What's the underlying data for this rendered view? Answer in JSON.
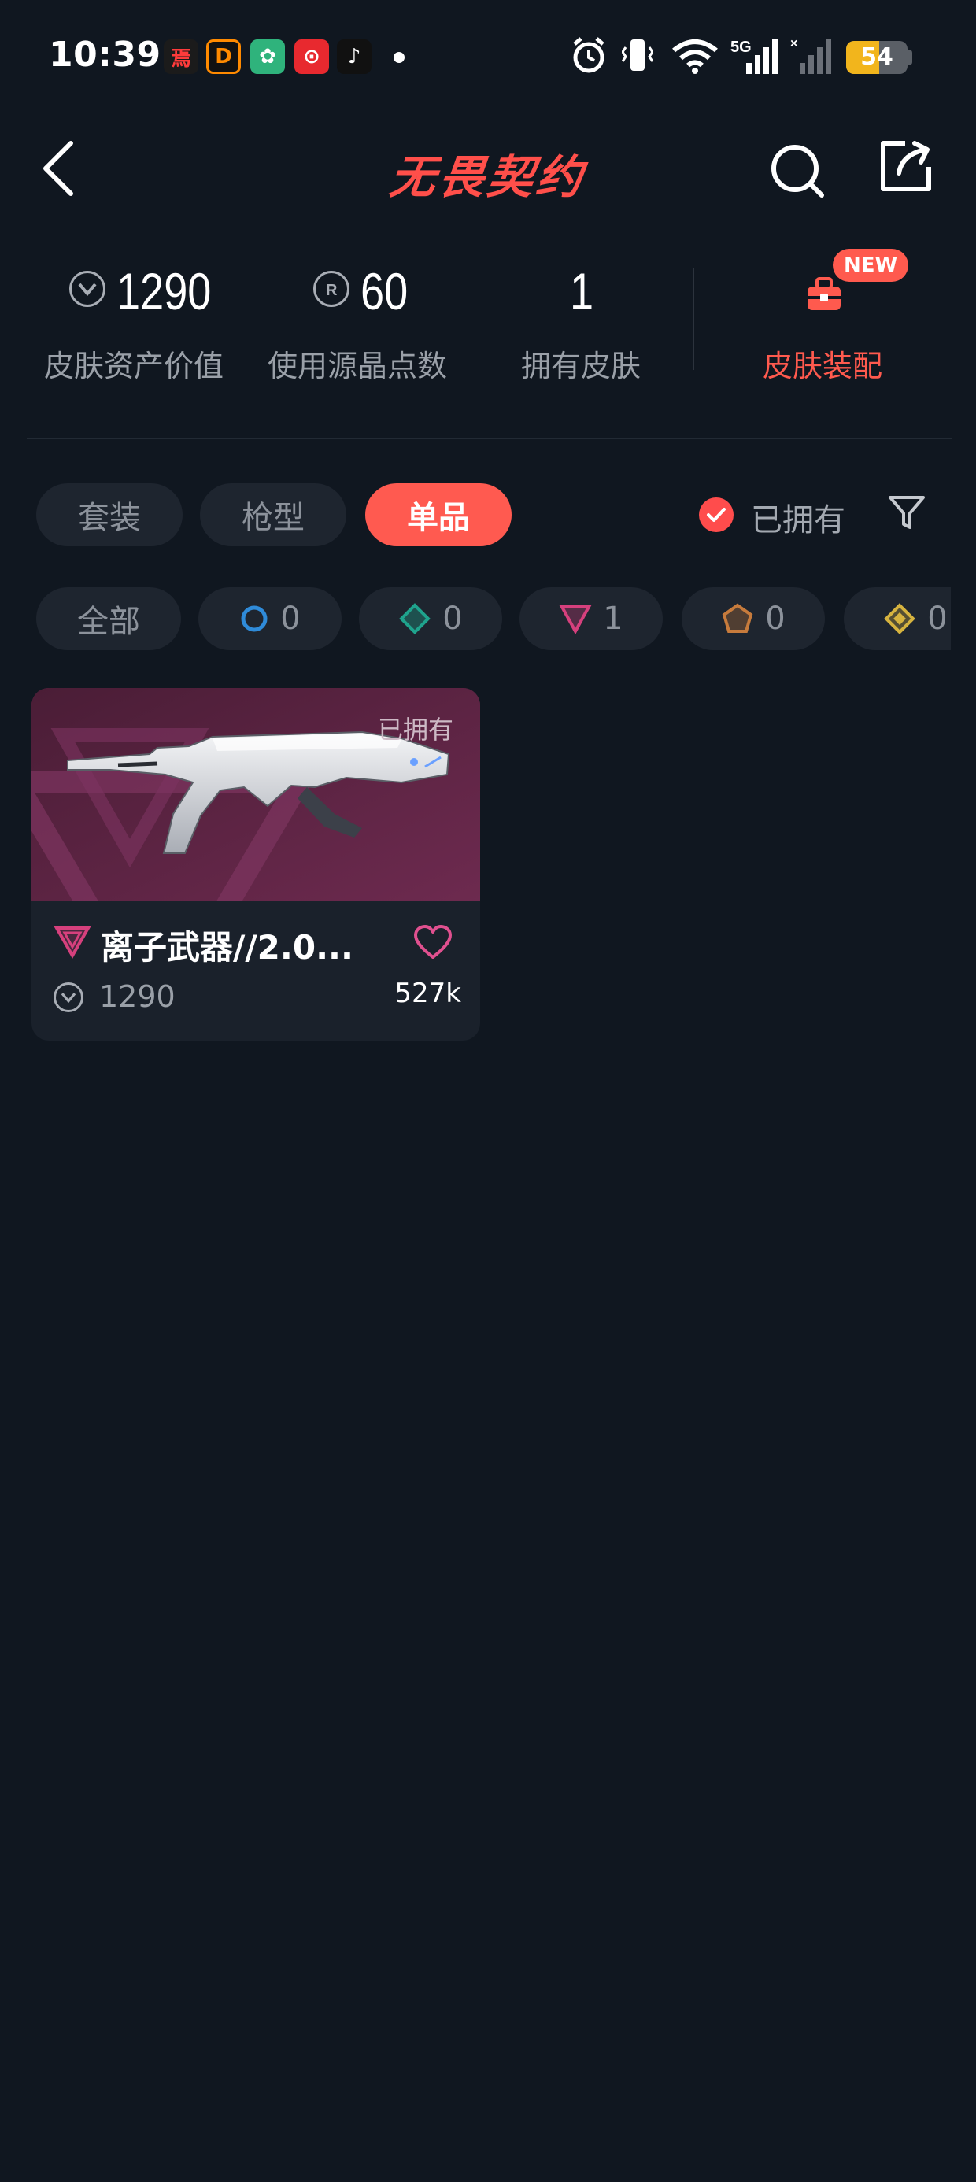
{
  "status_bar": {
    "time": "10:39",
    "battery": "54",
    "network": "5G"
  },
  "header": {
    "title": "无畏契约"
  },
  "stats": [
    {
      "value": "1290",
      "label": "皮肤资产价值"
    },
    {
      "value": "60",
      "label": "使用源晶点数"
    },
    {
      "value": "1",
      "label": "拥有皮肤"
    }
  ],
  "loadout": {
    "label": "皮肤装配",
    "badge": "NEW"
  },
  "tabs": [
    {
      "label": "套装"
    },
    {
      "label": "枪型"
    },
    {
      "label": "单品",
      "active": true
    }
  ],
  "filter": {
    "owned_label": "已拥有"
  },
  "rarity_chips": [
    {
      "label": "全部"
    },
    {
      "count": "0",
      "icon": "select-tier-icon",
      "color": "#2f8bd9"
    },
    {
      "count": "0",
      "icon": "deluxe-tier-icon",
      "color": "#1fa38d"
    },
    {
      "count": "1",
      "icon": "premium-tier-icon",
      "color": "#d6407d"
    },
    {
      "count": "0",
      "icon": "exclusive-tier-icon",
      "color": "#c77b3c"
    },
    {
      "count": "0",
      "icon": "ultra-tier-icon",
      "color": "#d6b33f"
    }
  ],
  "items": [
    {
      "name": "离子武器//2.0...",
      "owned_tag": "已拥有",
      "price": "1290",
      "likes": "527k",
      "tier_color": "#d6407d"
    }
  ],
  "colors": {
    "accent": "#ff5a50",
    "background": "#101720",
    "card": "#1a212b"
  }
}
